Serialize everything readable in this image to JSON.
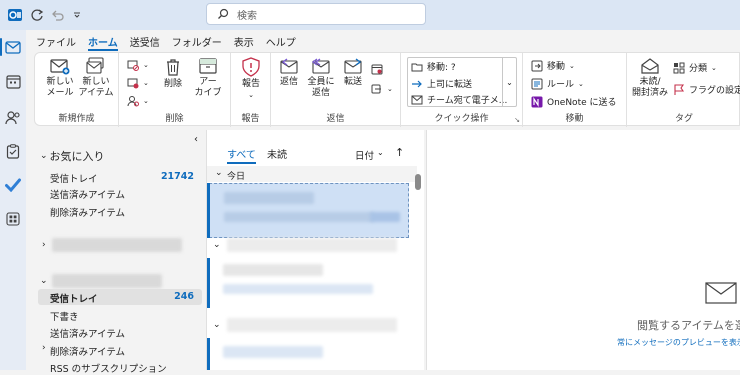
{
  "search": {
    "placeholder": "検索"
  },
  "menu": {
    "tabs": [
      "ファイル",
      "ホーム",
      "送受信",
      "フォルダー",
      "表示",
      "ヘルプ"
    ],
    "active": "ホーム"
  },
  "ribbon": {
    "new": {
      "mail": "新しい\nメール",
      "item": "新しい\nアイテム",
      "label": "新規作成"
    },
    "delete": {
      "delete": "削除",
      "archive": "アー\nカイブ",
      "label": "削除"
    },
    "report": {
      "report": "報告",
      "label": "報告"
    },
    "respond": {
      "reply": "返信",
      "reply_all": "全員に\n返信",
      "forward": "転送",
      "label": "返信"
    },
    "quick": {
      "move_to": "移動: ?",
      "to_manager": "上司に転送",
      "team_email": "チーム宛て電子メ...",
      "label": "クイック操作"
    },
    "move": {
      "move": "移動",
      "rules": "ルール",
      "onenote": "OneNote に送る",
      "label": "移動"
    },
    "tags": {
      "unread_read": "未読/\n開封済み",
      "categorize": "分類",
      "flag": "フラグの設定",
      "label": "タグ"
    }
  },
  "folders": {
    "favorites_header": "お気に入り",
    "favorites": [
      {
        "name": "受信トレイ",
        "count": "21742"
      },
      {
        "name": "送信済みアイテム",
        "count": ""
      },
      {
        "name": "削除済みアイテム",
        "count": ""
      }
    ],
    "account": [
      {
        "name": "受信トレイ",
        "count": "246"
      },
      {
        "name": "下書き",
        "count": ""
      },
      {
        "name": "送信済みアイテム",
        "count": ""
      },
      {
        "name": "削除済みアイテム",
        "count": ""
      },
      {
        "name": "RSS のサブスクリプション",
        "count": ""
      }
    ]
  },
  "message_list": {
    "tab_all": "すべて",
    "tab_unread": "未読",
    "sort": "日付",
    "group_today": "今日"
  },
  "reading_pane": {
    "title": "閲覧するアイテムを選",
    "link": "常にメッセージのプレビューを表示する"
  },
  "colors": {
    "accent": "#0f6cbd",
    "titlebar": "#dbe6f4",
    "selected_row": "#cfe0f5"
  }
}
